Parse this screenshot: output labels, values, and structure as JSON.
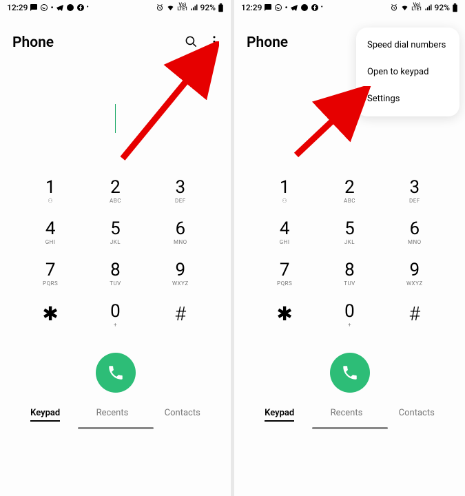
{
  "status": {
    "time": "12:29",
    "battery": "92%",
    "volte": "VoLTE1"
  },
  "header": {
    "title": "Phone"
  },
  "keypad": {
    "keys": [
      {
        "digit": "1",
        "sub": "⚇"
      },
      {
        "digit": "2",
        "sub": "ABC"
      },
      {
        "digit": "3",
        "sub": "DEF"
      },
      {
        "digit": "4",
        "sub": "GHI"
      },
      {
        "digit": "5",
        "sub": "JKL"
      },
      {
        "digit": "6",
        "sub": "MNO"
      },
      {
        "digit": "7",
        "sub": "PQRS"
      },
      {
        "digit": "8",
        "sub": "TUV"
      },
      {
        "digit": "9",
        "sub": "WXYZ"
      },
      {
        "digit": "✱",
        "sub": ""
      },
      {
        "digit": "0",
        "sub": "+"
      },
      {
        "digit": "#",
        "sub": ""
      }
    ]
  },
  "tabs": {
    "keypad": "Keypad",
    "recents": "Recents",
    "contacts": "Contacts"
  },
  "popup": {
    "speed_dial": "Speed dial numbers",
    "open_keypad": "Open to keypad",
    "settings": "Settings"
  }
}
